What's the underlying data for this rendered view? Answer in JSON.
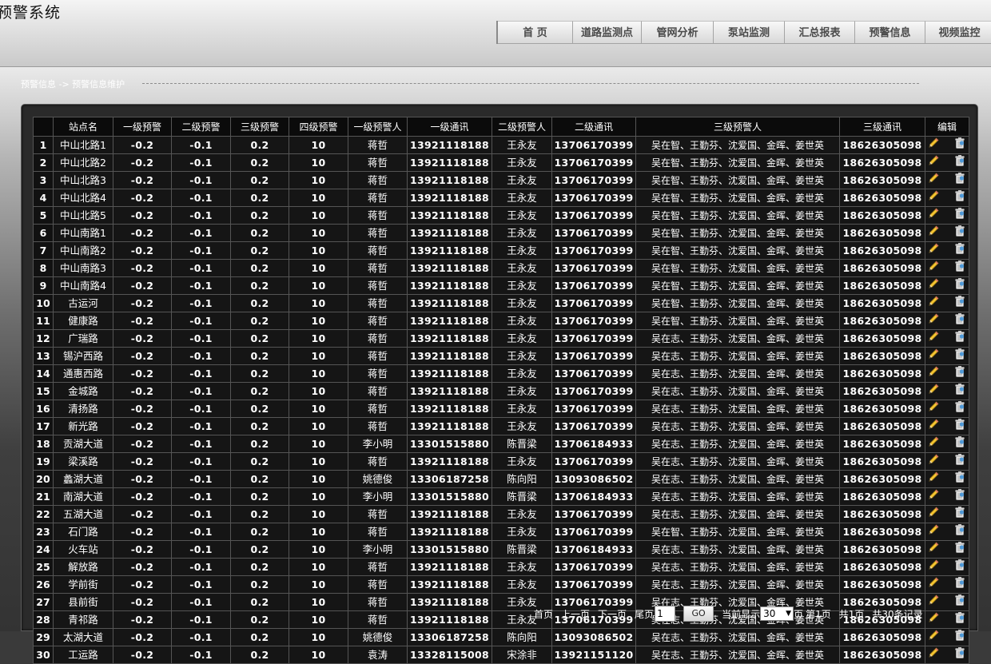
{
  "app": {
    "title": "预警系统"
  },
  "nav": {
    "items": [
      {
        "label": "首 页",
        "width": 94
      },
      {
        "label": "道路监测点",
        "width": 86
      },
      {
        "label": "管网分析",
        "width": 90
      },
      {
        "label": "泵站监测",
        "width": 89
      },
      {
        "label": "汇总报表",
        "width": 88
      },
      {
        "label": "预警信息",
        "width": 88
      },
      {
        "label": "视频监控",
        "width": 86
      }
    ]
  },
  "breadcrumb": {
    "text": "预警信息 -> 预警信息维护"
  },
  "table": {
    "columns": [
      "",
      "站点名",
      "一级预警",
      "二级预警",
      "三级预警",
      "四级预警",
      "一级预警人",
      "一级通讯",
      "二级预警人",
      "二级通讯",
      "三级预警人",
      "三级通讯",
      "编辑"
    ],
    "rows": [
      [
        "1",
        "中山北路1",
        "-0.2",
        "-0.1",
        "0.2",
        "10",
        "蒋哲",
        "13921118188",
        "王永友",
        "13706170399",
        "吴在智、王勤芬、沈爱国、金晖、姜世英",
        "18626305098"
      ],
      [
        "2",
        "中山北路2",
        "-0.2",
        "-0.1",
        "0.2",
        "10",
        "蒋哲",
        "13921118188",
        "王永友",
        "13706170399",
        "吴在智、王勤芬、沈爱国、金晖、姜世英",
        "18626305098"
      ],
      [
        "3",
        "中山北路3",
        "-0.2",
        "-0.1",
        "0.2",
        "10",
        "蒋哲",
        "13921118188",
        "王永友",
        "13706170399",
        "吴在智、王勤芬、沈爱国、金晖、姜世英",
        "18626305098"
      ],
      [
        "4",
        "中山北路4",
        "-0.2",
        "-0.1",
        "0.2",
        "10",
        "蒋哲",
        "13921118188",
        "王永友",
        "13706170399",
        "吴在智、王勤芬、沈爱国、金晖、姜世英",
        "18626305098"
      ],
      [
        "5",
        "中山北路5",
        "-0.2",
        "-0.1",
        "0.2",
        "10",
        "蒋哲",
        "13921118188",
        "王永友",
        "13706170399",
        "吴在智、王勤芬、沈爱国、金晖、姜世英",
        "18626305098"
      ],
      [
        "6",
        "中山南路1",
        "-0.2",
        "-0.1",
        "0.2",
        "10",
        "蒋哲",
        "13921118188",
        "王永友",
        "13706170399",
        "吴在智、王勤芬、沈爱国、金晖、姜世英",
        "18626305098"
      ],
      [
        "7",
        "中山南路2",
        "-0.2",
        "-0.1",
        "0.2",
        "10",
        "蒋哲",
        "13921118188",
        "王永友",
        "13706170399",
        "吴在智、王勤芬、沈爱国、金晖、姜世英",
        "18626305098"
      ],
      [
        "8",
        "中山南路3",
        "-0.2",
        "-0.1",
        "0.2",
        "10",
        "蒋哲",
        "13921118188",
        "王永友",
        "13706170399",
        "吴在智、王勤芬、沈爱国、金晖、姜世英",
        "18626305098"
      ],
      [
        "9",
        "中山南路4",
        "-0.2",
        "-0.1",
        "0.2",
        "10",
        "蒋哲",
        "13921118188",
        "王永友",
        "13706170399",
        "吴在智、王勤芬、沈爱国、金晖、姜世英",
        "18626305098"
      ],
      [
        "10",
        "古运河",
        "-0.2",
        "-0.1",
        "0.2",
        "10",
        "蒋哲",
        "13921118188",
        "王永友",
        "13706170399",
        "吴在智、王勤芬、沈爱国、金晖、姜世英",
        "18626305098"
      ],
      [
        "11",
        "健康路",
        "-0.2",
        "-0.1",
        "0.2",
        "10",
        "蒋哲",
        "13921118188",
        "王永友",
        "13706170399",
        "吴在智、王勤芬、沈爱国、金晖、姜世英",
        "18626305098"
      ],
      [
        "12",
        "广瑞路",
        "-0.2",
        "-0.1",
        "0.2",
        "10",
        "蒋哲",
        "13921118188",
        "王永友",
        "13706170399",
        "吴在志、王勤芬、沈爱国、金晖、姜世英",
        "18626305098"
      ],
      [
        "13",
        "锡沪西路",
        "-0.2",
        "-0.1",
        "0.2",
        "10",
        "蒋哲",
        "13921118188",
        "王永友",
        "13706170399",
        "吴在志、王勤芬、沈爱国、金晖、姜世英",
        "18626305098"
      ],
      [
        "14",
        "通惠西路",
        "-0.2",
        "-0.1",
        "0.2",
        "10",
        "蒋哲",
        "13921118188",
        "王永友",
        "13706170399",
        "吴在志、王勤芬、沈爱国、金晖、姜世英",
        "18626305098"
      ],
      [
        "15",
        "金城路",
        "-0.2",
        "-0.1",
        "0.2",
        "10",
        "蒋哲",
        "13921118188",
        "王永友",
        "13706170399",
        "吴在志、王勤芬、沈爱国、金晖、姜世英",
        "18626305098"
      ],
      [
        "16",
        "清扬路",
        "-0.2",
        "-0.1",
        "0.2",
        "10",
        "蒋哲",
        "13921118188",
        "王永友",
        "13706170399",
        "吴在志、王勤芬、沈爱国、金晖、姜世英",
        "18626305098"
      ],
      [
        "17",
        "新光路",
        "-0.2",
        "-0.1",
        "0.2",
        "10",
        "蒋哲",
        "13921118188",
        "王永友",
        "13706170399",
        "吴在志、王勤芬、沈爱国、金晖、姜世英",
        "18626305098"
      ],
      [
        "18",
        "贡湖大道",
        "-0.2",
        "-0.1",
        "0.2",
        "10",
        "李小明",
        "13301515880",
        "陈晋梁",
        "13706184933",
        "吴在志、王勤芬、沈爱国、金晖、姜世英",
        "18626305098"
      ],
      [
        "19",
        "梁溪路",
        "-0.2",
        "-0.1",
        "0.2",
        "10",
        "蒋哲",
        "13921118188",
        "王永友",
        "13706170399",
        "吴在志、王勤芬、沈爱国、金晖、姜世英",
        "18626305098"
      ],
      [
        "20",
        "蠡湖大道",
        "-0.2",
        "-0.1",
        "0.2",
        "10",
        "姚德俊",
        "13306187258",
        "陈向阳",
        "13093086502",
        "吴在志、王勤芬、沈爱国、金晖、姜世英",
        "18626305098"
      ],
      [
        "21",
        "南湖大道",
        "-0.2",
        "-0.1",
        "0.2",
        "10",
        "李小明",
        "13301515880",
        "陈晋梁",
        "13706184933",
        "吴在志、王勤芬、沈爱国、金晖、姜世英",
        "18626305098"
      ],
      [
        "22",
        "五湖大道",
        "-0.2",
        "-0.1",
        "0.2",
        "10",
        "蒋哲",
        "13921118188",
        "王永友",
        "13706170399",
        "吴在志、王勤芬、沈爱国、金晖、姜世英",
        "18626305098"
      ],
      [
        "23",
        "石门路",
        "-0.2",
        "-0.1",
        "0.2",
        "10",
        "蒋哲",
        "13921118188",
        "王永友",
        "13706170399",
        "吴在智、王勤芬、沈爱国、金晖、姜世英",
        "18626305098"
      ],
      [
        "24",
        "火车站",
        "-0.2",
        "-0.1",
        "0.2",
        "10",
        "李小明",
        "13301515880",
        "陈晋梁",
        "13706184933",
        "吴在志、王勤芬、沈爱国、金晖、姜世英",
        "18626305098"
      ],
      [
        "25",
        "解放路",
        "-0.2",
        "-0.1",
        "0.2",
        "10",
        "蒋哲",
        "13921118188",
        "王永友",
        "13706170399",
        "吴在志、王勤芬、沈爱国、金晖、姜世英",
        "18626305098"
      ],
      [
        "26",
        "学前街",
        "-0.2",
        "-0.1",
        "0.2",
        "10",
        "蒋哲",
        "13921118188",
        "王永友",
        "13706170399",
        "吴在志、王勤芬、沈爱国、金晖、姜世英",
        "18626305098"
      ],
      [
        "27",
        "县前街",
        "-0.2",
        "-0.1",
        "0.2",
        "10",
        "蒋哲",
        "13921118188",
        "王永友",
        "13706170399",
        "吴在志、王勤芬、沈爱国、金晖、姜世英",
        "18626305098"
      ],
      [
        "28",
        "青祁路",
        "-0.2",
        "-0.1",
        "0.2",
        "10",
        "蒋哲",
        "13921118188",
        "王永友",
        "13706170399",
        "吴在志、王勤芬、沈爱国、金晖、姜世英",
        "18626305098"
      ],
      [
        "29",
        "太湖大道",
        "-0.2",
        "-0.1",
        "0.2",
        "10",
        "姚德俊",
        "13306187258",
        "陈向阳",
        "13093086502",
        "吴在志、王勤芬、沈爱国、金晖、姜世英",
        "18626305098"
      ],
      [
        "30",
        "工运路",
        "-0.2",
        "-0.1",
        "0.2",
        "10",
        "袁涛",
        "13328115008",
        "宋涂非",
        "13921151120",
        "吴在志、王勤芬、沈爱国、金晖、姜世英",
        "18626305098"
      ]
    ],
    "row_icons": {
      "edit": "pencil-icon",
      "delete": "trash-icon"
    }
  },
  "pager": {
    "first": "首页",
    "prev": "上一页",
    "next": "下一页",
    "last": "尾页",
    "page_input": "1",
    "go": "GO",
    "show_prefix": "当前显示",
    "page_size": "30",
    "page_suffix": "页",
    "current": "第1页",
    "total_pages": "共1页",
    "total_records": "共30条记录"
  },
  "colors": {
    "accent": "#f4c430",
    "header_bg": "#d9d9d9",
    "table_bg": "#151515"
  }
}
